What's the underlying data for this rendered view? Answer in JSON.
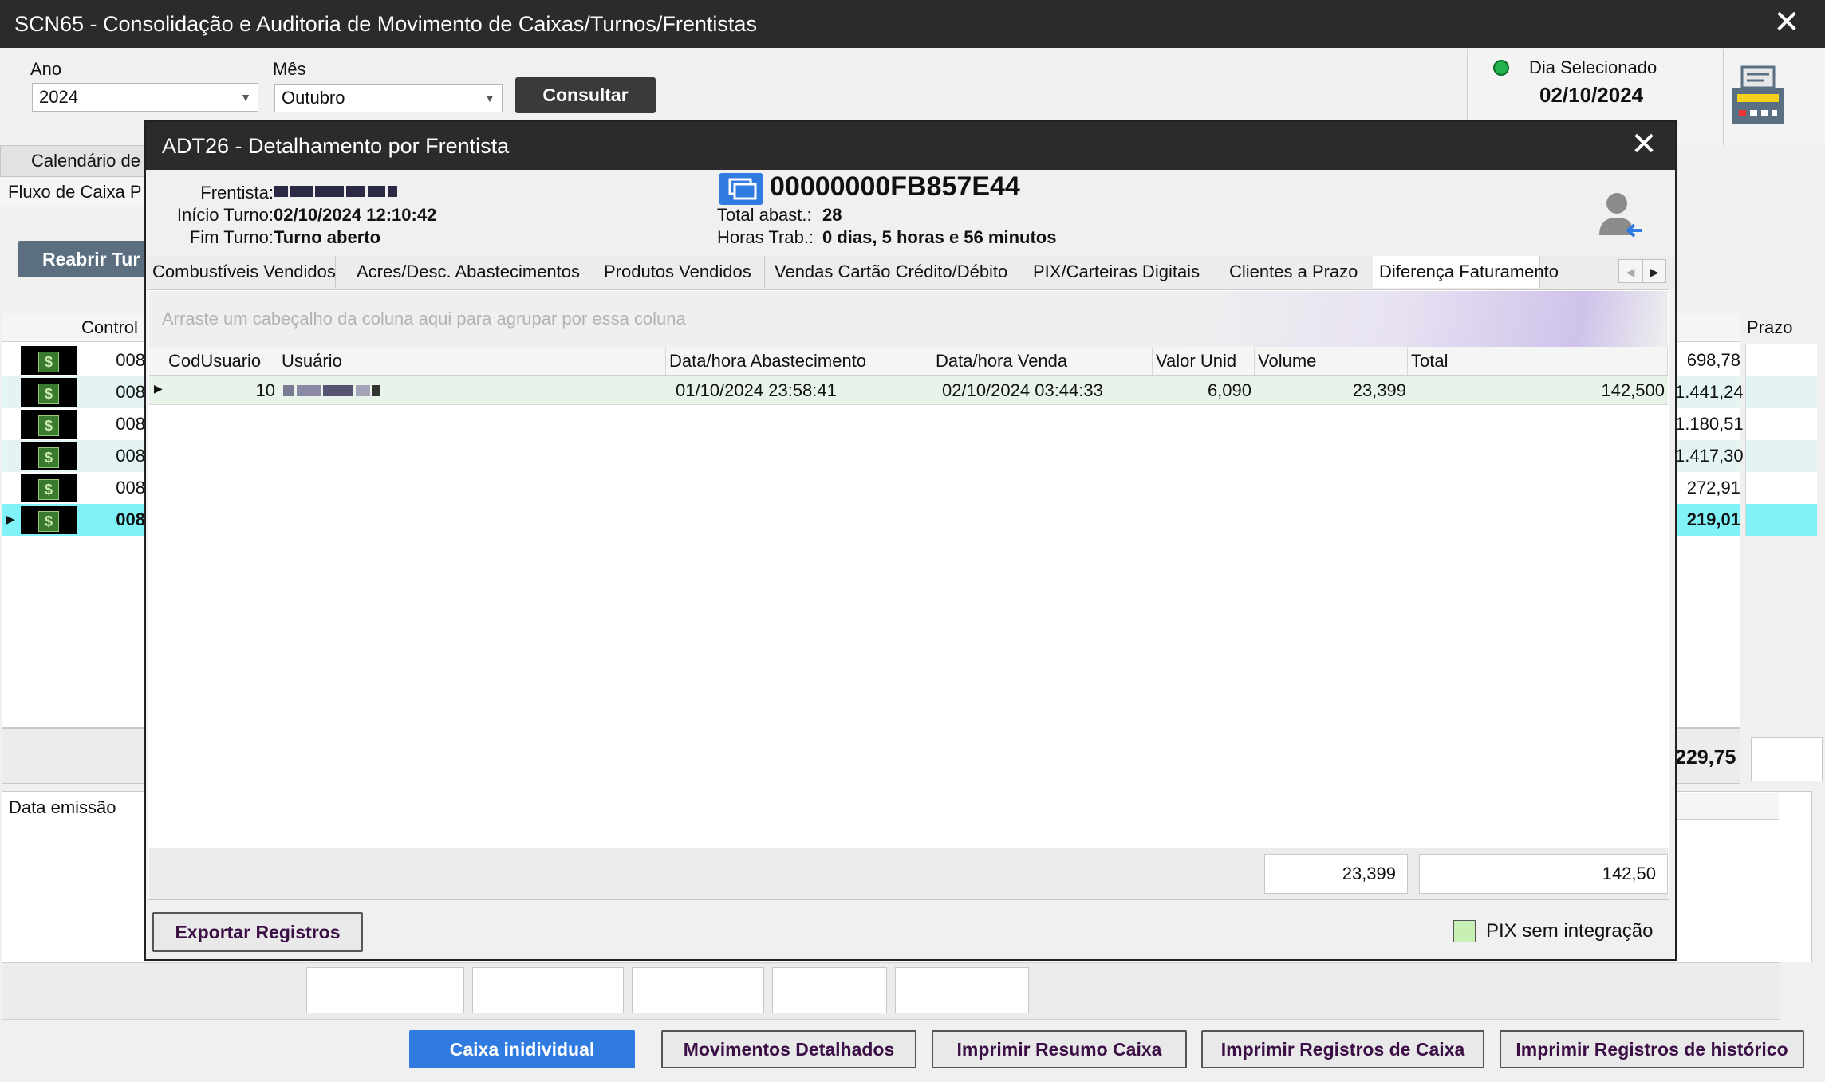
{
  "window": {
    "title": "SCN65 - Consolidação e Auditoria de Movimento de Caixas/Turnos/Frentistas"
  },
  "filters": {
    "ano_label": "Ano",
    "ano_value": "2024",
    "mes_label": "Mês",
    "mes_value": "Outubro",
    "consultar": "Consultar"
  },
  "day_panel": {
    "label": "Dia Selecionado",
    "date": "02/10/2024",
    "status_color": "#22b14c"
  },
  "main": {
    "tab_calendario": "Calendário de",
    "tab_fluxo": "Fluxo de Caixa P",
    "reabrir": "Reabrir Tur",
    "col_control": "Control",
    "col_prazo": "Prazo",
    "rows": [
      {
        "control": "008",
        "prazo": "698,78"
      },
      {
        "control": "008",
        "prazo": "1.441,24"
      },
      {
        "control": "008",
        "prazo": "1.180,51"
      },
      {
        "control": "008",
        "prazo": "1.417,30"
      },
      {
        "control": "008",
        "prazo": "272,91"
      },
      {
        "control": "008",
        "prazo": "219,01"
      }
    ],
    "total_prazo": "229,75",
    "data_emissao": "Data emissão"
  },
  "bottom_buttons": {
    "caixa": "Caixa inidividual",
    "movimentos": "Movimentos Detalhados",
    "resumo": "Imprimir Resumo Caixa",
    "registros": "Imprimir Registros de Caixa",
    "historico": "Imprimir Registros de histórico"
  },
  "dialog": {
    "title": "ADT26 - Detalhamento por Frentista",
    "frentista_label": "Frentista:",
    "inicio_label": "Início Turno:",
    "inicio_value": "02/10/2024 12:10:42",
    "fim_label": "Fim Turno:",
    "fim_value": "Turno aberto",
    "card_id": "00000000FB857E44",
    "total_abast_label": "Total abast.:",
    "total_abast_value": "28",
    "horas_label": "Horas Trab.:",
    "horas_value": "0 dias, 5 horas e 56 minutos",
    "tabs": [
      "Combustíveis Vendidos",
      "Acres/Desc. Abastecimentos",
      "Produtos Vendidos",
      "Vendas Cartão Crédito/Débito",
      "PIX/Carteiras Digitais",
      "Clientes a Prazo",
      "Diferença Faturamento"
    ],
    "group_hint": "Arraste um cabeçalho da coluna aqui para agrupar por essa coluna",
    "columns": {
      "cod": "CodUsuario",
      "usuario": "Usuário",
      "abast": "Data/hora Abastecimento",
      "venda": "Data/hora Venda",
      "valor": "Valor Unid",
      "volume": "Volume",
      "total": "Total"
    },
    "row": {
      "cod": "10",
      "abast": "01/10/2024 23:58:41",
      "venda": "02/10/2024 03:44:33",
      "valor": "6,090",
      "volume": "23,399",
      "total": "142,500"
    },
    "sum_volume": "23,399",
    "sum_total": "142,50",
    "export": "Exportar Registros",
    "pix_legend": "PIX sem integração",
    "pix_color": "#c8f0b4"
  }
}
